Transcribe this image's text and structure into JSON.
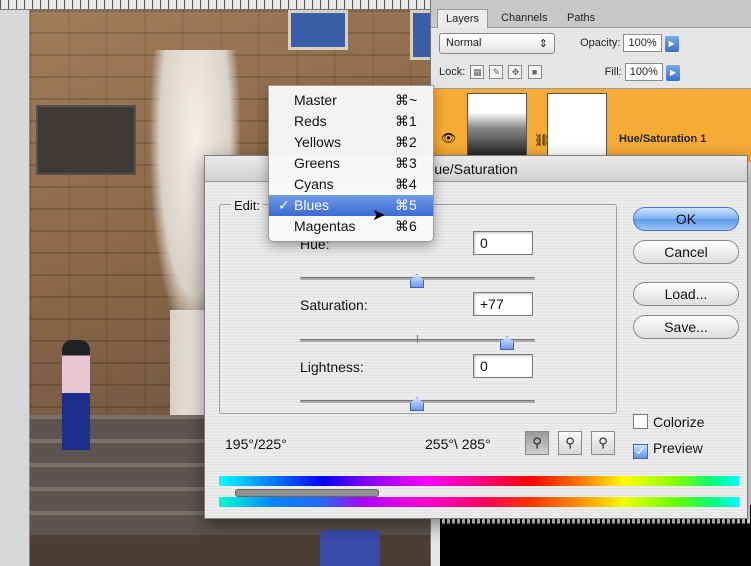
{
  "layers_panel": {
    "tabs": [
      "Layers",
      "Channels",
      "Paths"
    ],
    "blend_mode": "Normal",
    "opacity_label": "Opacity:",
    "opacity_value": "100%",
    "lock_label": "Lock:",
    "fill_label": "Fill:",
    "fill_value": "100%",
    "layer_name": "Hue/Saturation 1"
  },
  "dialog": {
    "title": "ue/Saturation",
    "edit_label": "Edit:",
    "hue": {
      "label": "Hue:",
      "value": "0"
    },
    "saturation": {
      "label": "Saturation:",
      "value": "+77"
    },
    "lightness": {
      "label": "Lightness:",
      "value": "0"
    },
    "buttons": {
      "ok": "OK",
      "cancel": "Cancel",
      "load": "Load...",
      "save": "Save..."
    },
    "colorize_label": "Colorize",
    "colorize_checked": false,
    "preview_label": "Preview",
    "preview_checked": true,
    "range_left": "195°/225°",
    "range_right": "255°\\ 285°"
  },
  "channel_menu": {
    "items": [
      {
        "label": "Master",
        "shortcut": "⌘~",
        "checked": false
      },
      {
        "label": "Reds",
        "shortcut": "⌘1",
        "checked": false
      },
      {
        "label": "Yellows",
        "shortcut": "⌘2",
        "checked": false
      },
      {
        "label": "Greens",
        "shortcut": "⌘3",
        "checked": false
      },
      {
        "label": "Cyans",
        "shortcut": "⌘4",
        "checked": false
      },
      {
        "label": "Blues",
        "shortcut": "⌘5",
        "checked": true
      },
      {
        "label": "Magentas",
        "shortcut": "⌘6",
        "checked": false
      }
    ],
    "check_mark": "✓"
  },
  "colors": {
    "layer_highlight": "#f7ab37",
    "menu_selection": "#3b6ad3",
    "accent_blue": "#5d97e8"
  }
}
